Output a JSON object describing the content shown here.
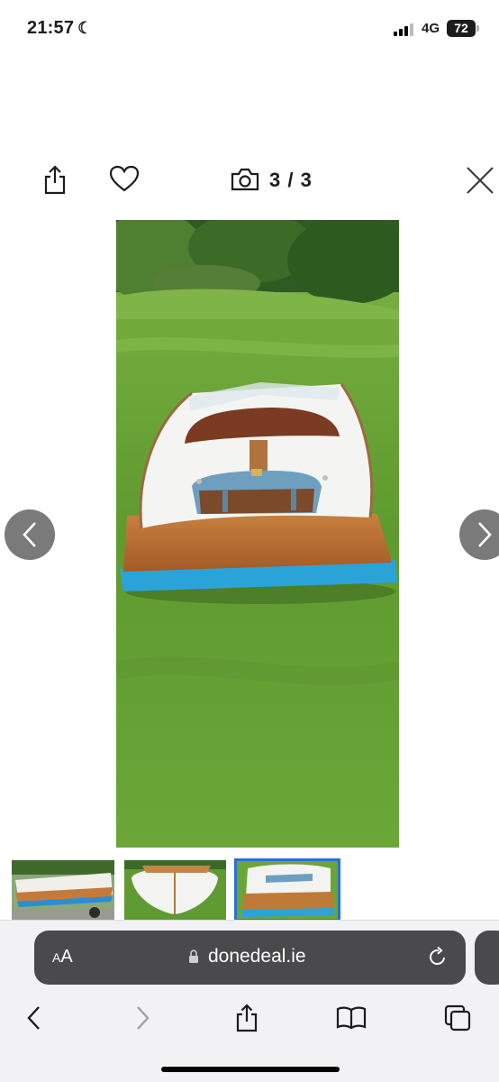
{
  "status_bar": {
    "time": "21:57",
    "network": "4G",
    "battery": "72"
  },
  "gallery": {
    "counter": "3 / 3",
    "icons": {
      "share": "share-icon",
      "favorite": "heart-icon",
      "camera": "camera-icon",
      "close": "close-icon",
      "prev": "chevron-left-icon",
      "next": "chevron-right-icon"
    },
    "thumbnails": [
      {
        "label": "photo-1",
        "selected": false
      },
      {
        "label": "photo-2",
        "selected": false
      },
      {
        "label": "photo-3",
        "selected": true
      }
    ],
    "colors": {
      "accent": "#2a6fd6",
      "grass": "#6aa33a",
      "hull_blue": "#2aa3d8",
      "deck_white": "#f4f4f2",
      "wood": "#b5692f"
    }
  },
  "browser": {
    "aa_label_big": "A",
    "aa_label_small": "A",
    "url": "donedeal.ie",
    "toolbar_icons": [
      "back-icon",
      "forward-icon",
      "share-icon",
      "bookmarks-icon",
      "tabs-icon"
    ]
  }
}
